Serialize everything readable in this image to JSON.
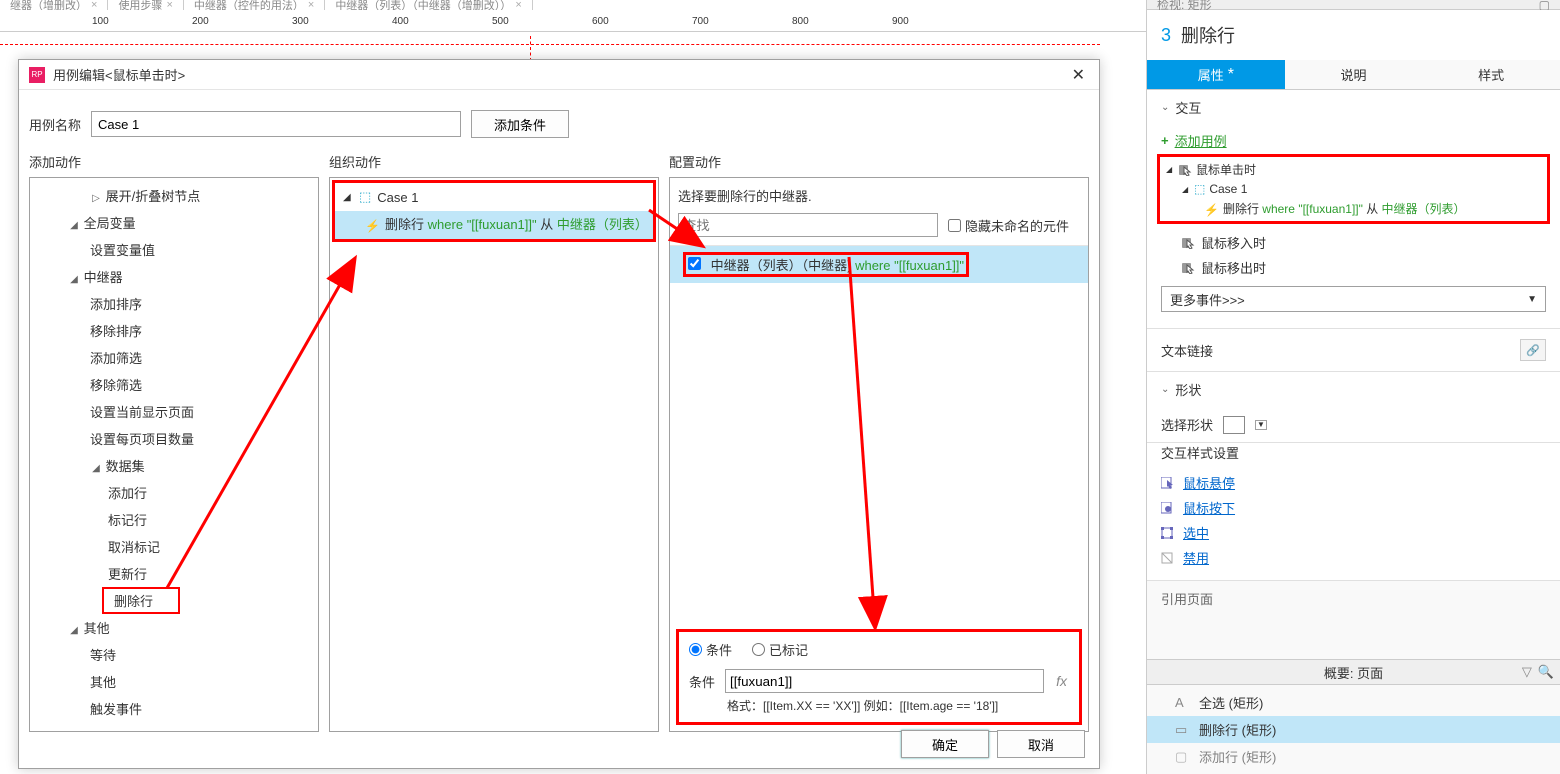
{
  "page_tabs": [
    {
      "label": "继器（增删改）",
      "active": true
    },
    {
      "label": "使用步骤",
      "active": false
    },
    {
      "label": "中继器（控件的用法）",
      "active": false
    },
    {
      "label": "中继器（列表）（中继器（增删改））",
      "active": false
    }
  ],
  "ruler_ticks": [
    100,
    200,
    300,
    400,
    500,
    600,
    700,
    800,
    900
  ],
  "dialog": {
    "title": "用例编辑<鼠标单击时>",
    "case_name_label": "用例名称",
    "case_name_value": "Case 1",
    "add_condition_btn": "添加条件",
    "col1_title": "添加动作",
    "col2_title": "组织动作",
    "col3_title": "配置动作",
    "actions_tree": {
      "expand_collapse": "展开/折叠树节点",
      "global_vars": "全局变量",
      "set_var": "设置变量值",
      "repeater": "中继器",
      "add_sort": "添加排序",
      "remove_sort": "移除排序",
      "add_filter": "添加筛选",
      "remove_filter": "移除筛选",
      "set_current_page": "设置当前显示页面",
      "set_items_per_page": "设置每页项目数量",
      "dataset": "数据集",
      "add_row": "添加行",
      "mark_row": "标记行",
      "unmark_row": "取消标记",
      "update_row": "更新行",
      "delete_row": "删除行",
      "other": "其他",
      "wait": "等待",
      "other_item": "其他",
      "trigger_event": "触发事件"
    },
    "organize": {
      "case_label": "Case 1",
      "action_prefix": "删除行 ",
      "action_where": "where \"[[fuxuan1]]\"",
      "action_suffix_from": " 从 ",
      "action_suffix_target": "中继器（列表）"
    },
    "configure": {
      "select_label": "选择要删除行的中继器.",
      "search_placeholder": "查找",
      "hide_unnamed": "隐藏未命名的元件",
      "widget_text_1": "中继器（列表）（中继器) ",
      "widget_text_where": "where \"[[fuxuan1]]\"",
      "radio_condition": "条件",
      "radio_marked": "已标记",
      "condition_label": "条件",
      "condition_value": "[[fuxuan1]]",
      "fx_label": "fx",
      "hint": "格式：[[Item.XX == 'XX']] 例如：[[Item.age == '18']]"
    },
    "ok_btn": "确定",
    "cancel_btn": "取消"
  },
  "inspector": {
    "title_top": "检视: 矩形",
    "num": "3",
    "title": "删除行",
    "tabs": {
      "props": "属性",
      "notes": "说明",
      "style": "样式"
    },
    "interaction": "交互",
    "add_case": "添加用例",
    "events": {
      "click": "鼠标单击时",
      "case": "Case 1",
      "action_prefix": "删除行 ",
      "action_where": "where \"[[fuxuan1]]\"",
      "action_suffix_from": " 从 ",
      "action_suffix_target": "中继器（列表）",
      "mousein": "鼠标移入时",
      "mouseout": "鼠标移出时"
    },
    "more_events": "更多事件>>>",
    "text_link": "文本链接",
    "shape": "形状",
    "select_shape": "选择形状",
    "interaction_styles_title": "交互样式设置",
    "styles": {
      "hover": "鼠标悬停",
      "mousedown": "鼠标按下",
      "selected": "选中",
      "disabled": "禁用"
    },
    "quote": "引用页面",
    "outline_title": "概要: 页面",
    "outline_items": [
      {
        "label": "全选 (矩形)",
        "icon": "A",
        "selected": false
      },
      {
        "label": "删除行 (矩形)",
        "icon": "—",
        "selected": true
      },
      {
        "label": "添加行 (矩形)",
        "icon": "□",
        "selected": false
      }
    ]
  }
}
